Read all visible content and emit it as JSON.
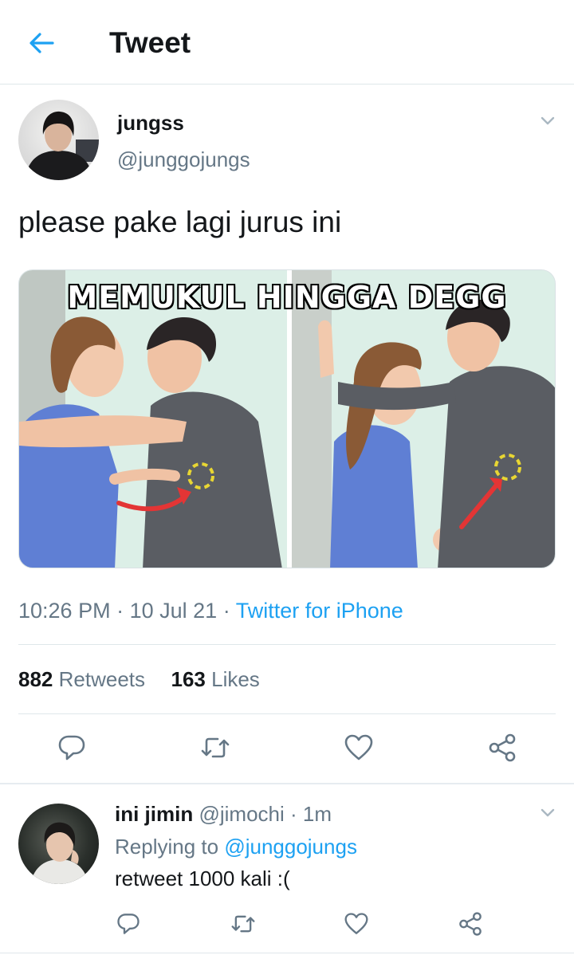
{
  "header": {
    "title": "Tweet",
    "back_icon": "back-arrow-icon"
  },
  "colors": {
    "accent": "#1da1f2",
    "secondary_text": "#657786",
    "divider": "#dfe7ea"
  },
  "tweet": {
    "author_name": "jungss",
    "author_handle": "@junggojungs",
    "text": "please pake lagi jurus ini",
    "media": {
      "caption": "MEMUKUL HINGGA DEGG"
    },
    "time": "10:26 PM",
    "date": "10 Jul 21",
    "source": "Twitter for iPhone",
    "retweet_count": "882",
    "retweets_label": "Retweets",
    "like_count": "163",
    "likes_label": "Likes",
    "actions": [
      "reply-icon",
      "retweet-icon",
      "like-icon",
      "share-icon"
    ]
  },
  "reply": {
    "author_name": "ini jimin",
    "author_handle": "@jimochi",
    "time": "1m",
    "replying_to_label": "Replying to",
    "replying_to_handle": "@junggojungs",
    "text": "retweet 1000 kali :(",
    "actions": [
      "reply-icon",
      "retweet-icon",
      "like-icon",
      "share-icon"
    ]
  },
  "separators": {
    "dot": "·"
  }
}
